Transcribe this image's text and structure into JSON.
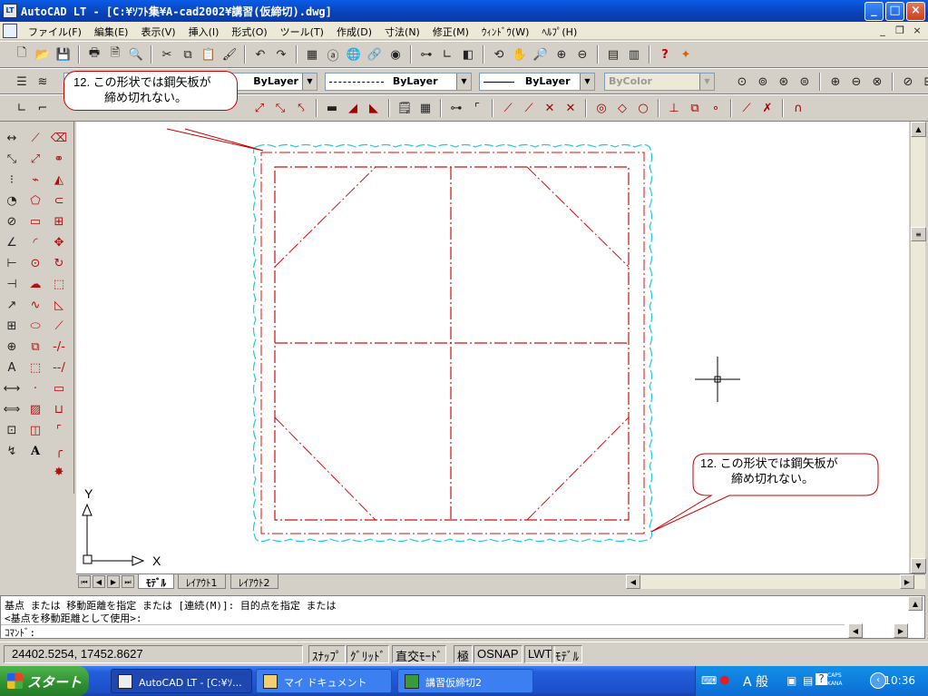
{
  "window": {
    "title": "AutoCAD LT - [C:¥ｿﾌﾄ集¥A-cad2002¥講習(仮締切).dwg]",
    "app_icon": "LT",
    "minimize_icon": "_",
    "maximize_icon": "□",
    "close_icon": "×"
  },
  "menu": {
    "items": [
      "ファイル(F)",
      "編集(E)",
      "表示(V)",
      "挿入(I)",
      "形式(O)",
      "ツール(T)",
      "作成(D)",
      "寸法(N)",
      "修正(M)",
      "ｳｨﾝﾄﾞｳ(W)",
      "ﾍﾙﾌﾟ(H)"
    ],
    "doc_minimize": "_",
    "doc_restore": "❐",
    "doc_close": "×"
  },
  "properties": {
    "color": "ByLayer",
    "linetype": "ByLayer",
    "lineweight": "ByLayer",
    "plotstyle": "ByColor"
  },
  "drawing": {
    "callout_top": {
      "line1": "12. この形状では鋼矢板が",
      "line2": "締め切れない。"
    },
    "callout_bottom": {
      "line1": "12. この形状では鋼矢板が",
      "line2": "締め切れない。"
    },
    "ucs_x": "X",
    "ucs_y": "Y",
    "colors": {
      "frame": "#d01010",
      "sheetpile": "#20c8e0",
      "callout_border": "#c80000"
    }
  },
  "layout_tabs": [
    "ﾓﾃﾞﾙ",
    "ﾚｲｱｳﾄ1",
    "ﾚｲｱｳﾄ2"
  ],
  "command": {
    "line1": "基点 または 移動距離を指定 または [連続(M)]: 目的点を指定 または",
    "line2": "<基点を移動距離として使用>:",
    "prompt": "ｺﾏﾝﾄﾞ:"
  },
  "status": {
    "coords": "24402.5254, 17452.8627",
    "buttons": [
      "ｽﾅｯﾌﾟ",
      "ｸﾞﾘｯﾄﾞ",
      "直交ﾓｰﾄﾞ",
      "極",
      "OSNAP",
      "LWT",
      "ﾓﾃﾞﾙ"
    ]
  },
  "taskbar": {
    "start": "スタート",
    "tasks": [
      "AutoCAD LT - [C:¥ｿ...",
      "マイ ドキュメント",
      "講習仮締切2"
    ],
    "ime": "A 般",
    "caps": "CAPS",
    "kana": "KANA",
    "clock": "10:36"
  }
}
